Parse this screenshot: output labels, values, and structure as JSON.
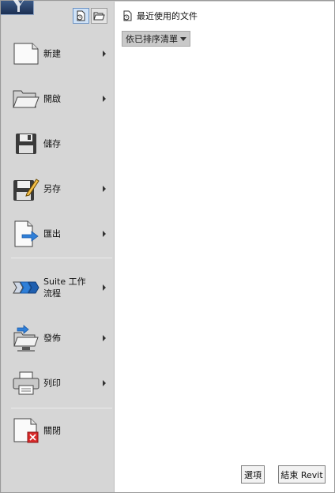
{
  "sidebar": {
    "items": [
      {
        "label": "新建",
        "icon": "new-document-icon",
        "has_submenu": true
      },
      {
        "label": "開啟",
        "icon": "open-folder-icon",
        "has_submenu": true
      },
      {
        "label": "儲存",
        "icon": "save-floppy-icon",
        "has_submenu": false
      },
      {
        "label": "另存",
        "icon": "save-as-icon",
        "has_submenu": true
      },
      {
        "label": "匯出",
        "icon": "export-icon",
        "has_submenu": true
      },
      {
        "label": "Suite 工作\n流程",
        "icon": "suite-workflow-icon",
        "has_submenu": true
      },
      {
        "label": "發佈",
        "icon": "publish-icon",
        "has_submenu": true
      },
      {
        "label": "列印",
        "icon": "printer-icon",
        "has_submenu": true
      },
      {
        "label": "關閉",
        "icon": "close-document-icon",
        "has_submenu": false
      }
    ]
  },
  "recent": {
    "title": "最近使用的文件",
    "sort_value": "依已排序清單"
  },
  "footer": {
    "options_label": "選項",
    "exit_label": "結束 Revit"
  },
  "colors": {
    "accent_blue": "#2f7fd8",
    "close_red": "#d92b2b"
  }
}
